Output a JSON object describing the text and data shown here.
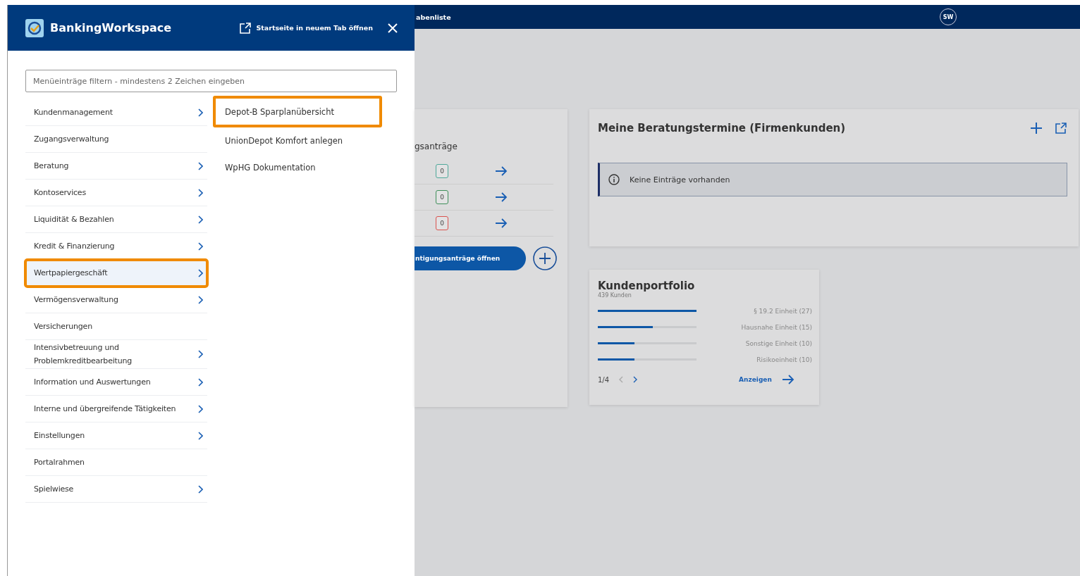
{
  "drawer": {
    "title": "BankingWorkspace",
    "open_in_tab": "Startseite in neuem Tab öffnen",
    "filter": {
      "placeholder": "Menüeinträge filtern - mindestens 2 Zeichen eingeben"
    },
    "menu": [
      {
        "label": "Kundenmanagement",
        "has_submenu": true,
        "selected": false,
        "highlighted": false
      },
      {
        "label": "Zugangsverwaltung",
        "has_submenu": false,
        "selected": false,
        "highlighted": false
      },
      {
        "label": "Beratung",
        "has_submenu": true,
        "selected": false,
        "highlighted": false
      },
      {
        "label": "Kontoservices",
        "has_submenu": true,
        "selected": false,
        "highlighted": false
      },
      {
        "label": "Liquidität & Bezahlen",
        "has_submenu": true,
        "selected": false,
        "highlighted": false
      },
      {
        "label": "Kredit & Finanzierung",
        "has_submenu": true,
        "selected": false,
        "highlighted": false
      },
      {
        "label": "Wertpapiergeschäft",
        "has_submenu": true,
        "selected": true,
        "highlighted": true
      },
      {
        "label": "Vermögensverwaltung",
        "has_submenu": true,
        "selected": false,
        "highlighted": false
      },
      {
        "label": "Versicherungen",
        "has_submenu": false,
        "selected": false,
        "highlighted": false
      },
      {
        "label": "Intensivbetreuung und Problemkreditbearbeitung",
        "has_submenu": true,
        "selected": false,
        "highlighted": false
      },
      {
        "label": "Information und Auswertungen",
        "has_submenu": true,
        "selected": false,
        "highlighted": false
      },
      {
        "label": "Interne und übergreifende Tätigkeiten",
        "has_submenu": true,
        "selected": false,
        "highlighted": false
      },
      {
        "label": "Einstellungen",
        "has_submenu": true,
        "selected": false,
        "highlighted": false
      },
      {
        "label": "Portalrahmen",
        "has_submenu": false,
        "selected": false,
        "highlighted": false
      },
      {
        "label": "Spielwiese",
        "has_submenu": true,
        "selected": false,
        "highlighted": false
      }
    ],
    "submenu": [
      {
        "label": "Depot-B Sparplanübersicht",
        "highlighted": true
      },
      {
        "label": "UnionDepot Komfort anlegen",
        "highlighted": false
      },
      {
        "label": "WpHG Dokumentation",
        "highlighted": false
      }
    ]
  },
  "topbar": {
    "title": "abenliste",
    "avatar": "SW"
  },
  "requests_card": {
    "title": "gsanträge",
    "rows": [
      {
        "count": "0",
        "color": "#4fa89a"
      },
      {
        "count": "0",
        "color": "#3f8f5a"
      },
      {
        "count": "0",
        "color": "#d9534f"
      }
    ],
    "button": "ntigungsanträge öffnen"
  },
  "appointments_card": {
    "title": "Meine Beratungstermine (Firmenkunden)",
    "notice": "Keine Einträge vorhanden"
  },
  "portfolio_card": {
    "title": "Kundenportfolio",
    "subtitle": "439 Kunden",
    "rows": [
      {
        "label": "§ 19.2 Einheit (27)",
        "level": 1
      },
      {
        "label": "Hausnahe Einheit (15)",
        "level": 0.56
      },
      {
        "label": "Sonstige Einheit (10)",
        "level": 0.37
      },
      {
        "label": "Risikoeinheit (10)",
        "level": 0.37
      }
    ],
    "page": "1/4",
    "action": "Anzeigen"
  }
}
